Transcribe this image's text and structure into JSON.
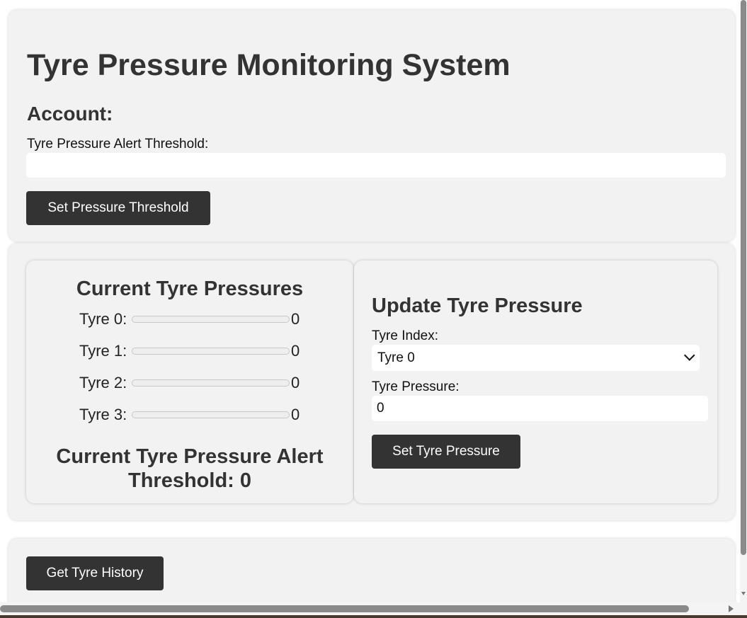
{
  "header": {
    "title": "Tyre Pressure Monitoring System",
    "account_label": "Account:"
  },
  "threshold_form": {
    "label": "Tyre Pressure Alert Threshold:",
    "value": "",
    "placeholder": "",
    "button_label": "Set Pressure Threshold"
  },
  "current_pressures": {
    "heading": "Current Tyre Pressures",
    "tyres": [
      {
        "label": "Tyre 0:",
        "value": "0",
        "fill_fraction": 0
      },
      {
        "label": "Tyre 1:",
        "value": "0",
        "fill_fraction": 0
      },
      {
        "label": "Tyre 2:",
        "value": "0",
        "fill_fraction": 0
      },
      {
        "label": "Tyre 3:",
        "value": "0",
        "fill_fraction": 0
      }
    ],
    "alert_threshold_text": "Current Tyre Pressure Alert Threshold: 0"
  },
  "update_form": {
    "heading": "Update Tyre Pressure",
    "index_label": "Tyre Index:",
    "index_selected": "Tyre 0",
    "pressure_label": "Tyre Pressure:",
    "pressure_value": "0",
    "button_label": "Set Tyre Pressure"
  },
  "history": {
    "button_label": "Get Tyre History"
  },
  "colors": {
    "card_background": "#f2f2f2",
    "button_background": "#333333",
    "button_text": "#ffffff",
    "text": "#333333"
  }
}
